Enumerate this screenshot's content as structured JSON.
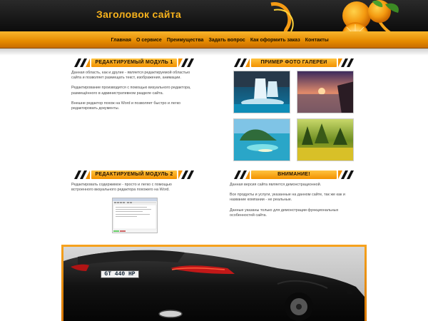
{
  "site": {
    "title": "Заголовок сайта"
  },
  "nav": {
    "items": [
      "Главная",
      "О сервисе",
      "Преимущества",
      "Задать вопрос",
      "Как оформить заказ",
      "Контакты"
    ]
  },
  "module1": {
    "heading": "РЕДАКТИРУЕМЫЙ МОДУЛЬ 1",
    "paragraphs": [
      "Данная область, как и другие - является редактируемой областью сайта и позволяет размещать текст, изображения, анимации.",
      "Редактирование производится с помощью визуального редактора, размещённого в административном разделе сайта.",
      "Внешне редактор похож на Word и позволяет быстро и легко редактировать документы."
    ]
  },
  "gallery": {
    "heading": "ПРИМЕР ФОТО ГАЛЕРЕИ",
    "images": [
      "waterfall-photo",
      "sunset-photo",
      "island-photo",
      "forest-photo"
    ]
  },
  "module2": {
    "heading": "РЕДАКТИРУЕМЫЙ МОДУЛЬ 2",
    "paragraphs": [
      "Редактировать содержимое - просто и легко с помощью встроенного визуального редактора похожего на Word."
    ]
  },
  "attention": {
    "heading": "ВНИМАНИЕ!",
    "paragraphs": [
      "Данная версия сайта является демонстрационной.",
      "Все продукты и услуги, указанные на данном сайте, так же как и название компании - не реальные.",
      "Данные указаны только для демонстрации функциональных особенностей сайта."
    ]
  },
  "banner": {
    "plate": "GT 440 HP"
  },
  "colors": {
    "accent": "#f39200",
    "title": "#f7b21c",
    "header_bg": "#111111"
  }
}
